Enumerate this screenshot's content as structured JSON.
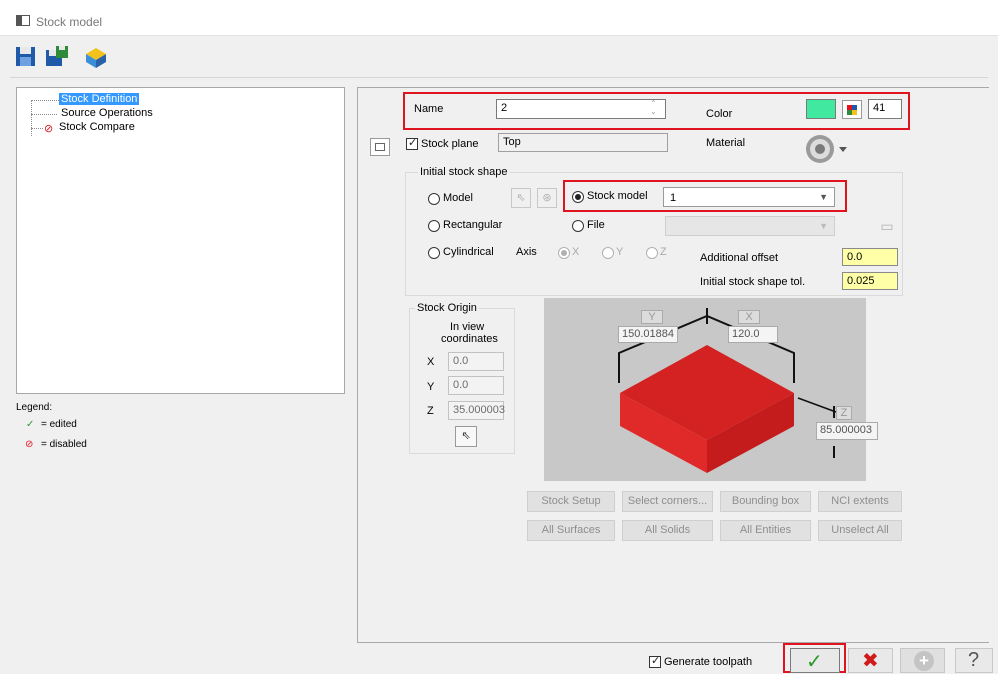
{
  "window": {
    "title": "Stock model"
  },
  "toolbar": {
    "icons": [
      "save-icon",
      "save-all-icon",
      "stock-model-icon"
    ]
  },
  "tree": {
    "items": [
      {
        "label": "Stock Definition",
        "state": "selected"
      },
      {
        "label": "Source Operations",
        "state": "normal"
      },
      {
        "label": "Stock Compare",
        "state": "disabled"
      }
    ]
  },
  "legend": {
    "title": "Legend:",
    "edited": "= edited",
    "disabled": "= disabled"
  },
  "form": {
    "name_label": "Name",
    "name_value": "2",
    "color_label": "Color",
    "color_swatch": "#40e8a0",
    "color_number": "41",
    "stock_plane_label": "Stock plane",
    "stock_plane_checked": true,
    "stock_plane_value": "Top",
    "material_label": "Material"
  },
  "shape": {
    "group_label": "Initial stock shape",
    "model_label": "Model",
    "rectangular_label": "Rectangular",
    "cylindrical_label": "Cylindrical",
    "stock_model_label": "Stock model",
    "stock_model_value": "1",
    "file_label": "File",
    "axis_label": "Axis",
    "axis_x": "X",
    "axis_y": "Y",
    "axis_z": "Z",
    "additional_offset_label": "Additional offset",
    "additional_offset_value": "0.0",
    "tol_label": "Initial stock shape tol.",
    "tol_value": "0.025"
  },
  "origin": {
    "group_label": "Stock Origin",
    "caption_line1": "In view",
    "caption_line2": "coordinates",
    "x_label": "X",
    "x_value": "0.0",
    "y_label": "Y",
    "y_value": "0.0",
    "z_label": "Z",
    "z_value": "35.000003"
  },
  "preview": {
    "y_label": "Y",
    "y_value": "150.01884",
    "x_label": "X",
    "x_value": "120.0",
    "z_label": "Z",
    "z_value": "85.000003",
    "stock_color": "#e02020"
  },
  "buttons": {
    "stock_setup": "Stock Setup",
    "select_corners": "Select corners...",
    "bounding_box": "Bounding box",
    "nci_extents": "NCI extents",
    "all_surfaces": "All Surfaces",
    "all_solids": "All Solids",
    "all_entities": "All Entities",
    "unselect_all": "Unselect All"
  },
  "footer": {
    "generate_toolpath_label": "Generate toolpath",
    "generate_toolpath_checked": true
  }
}
